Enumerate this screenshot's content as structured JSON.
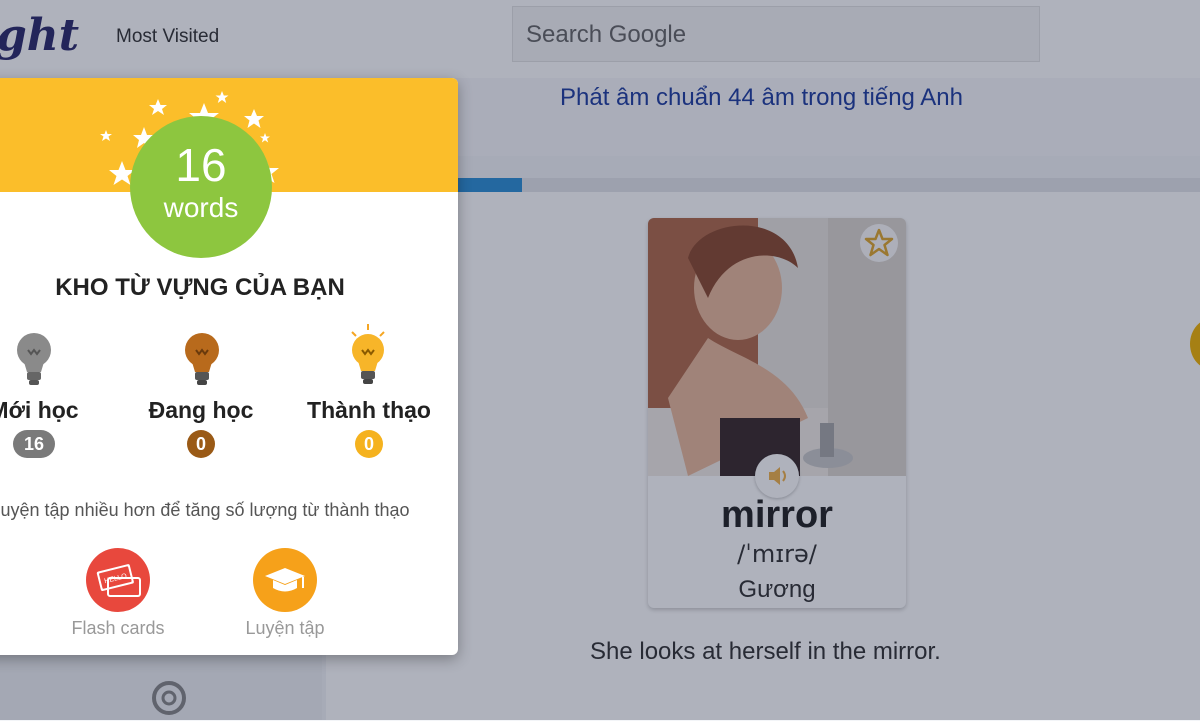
{
  "browser": {
    "logo_text": "ght",
    "most_visited_label": "Most Visited",
    "search_placeholder": "Search Google"
  },
  "page": {
    "banner_link": "Phát âm chuẩn 44 âm trong tiếng Anh",
    "lesson_progress": 0.435,
    "example_sentence": "She looks at herself in the mirror."
  },
  "flashcard": {
    "word": "mirror",
    "ipa": "/ˈmɪrə/",
    "meaning": "Gương",
    "favorite_icon": "star-icon",
    "sound_icon": "speaker-icon"
  },
  "popup": {
    "word_count": "16",
    "word_count_unit": "words",
    "title": "KHO TỪ VỰNG CỦA BẠN",
    "levels": [
      {
        "label": "Mới học",
        "count": "16",
        "color": "#7a7a7a"
      },
      {
        "label": "Đang học",
        "count": "0",
        "color": "#9a5a16"
      },
      {
        "label": "Thành thạo",
        "count": "0",
        "color": "#f5b21e"
      }
    ],
    "hint": "Luyện tập nhiều hơn để tăng số lượng từ thành thạo",
    "actions": [
      {
        "label": "Flash cards",
        "icon": "flash-cards-icon",
        "color": "#e8483d",
        "card_text": "HELLO"
      },
      {
        "label": "Luyện tập",
        "icon": "graduation-cap-icon",
        "color": "#f6a11a"
      }
    ]
  },
  "colors": {
    "header_yellow": "#fbbe2a",
    "count_green": "#8dc63f",
    "progress_blue": "#2d8fd5",
    "link_blue": "#1f3ea0"
  }
}
